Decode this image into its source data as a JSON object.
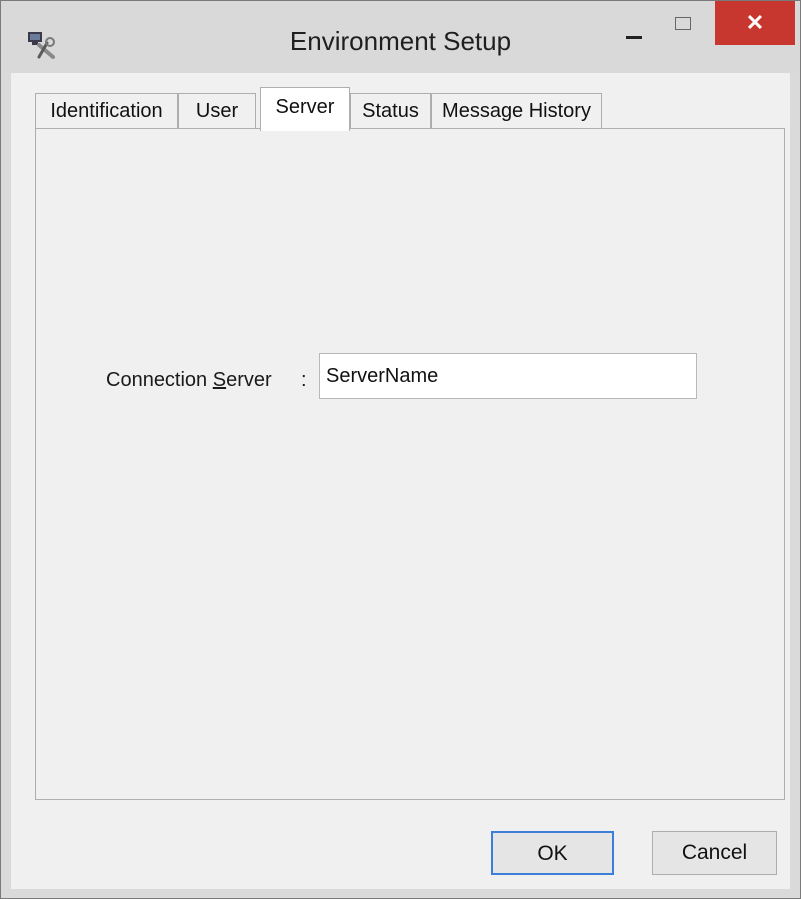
{
  "window": {
    "title": "Environment Setup",
    "close_glyph": "✕",
    "icons": [
      "app-tools-icon",
      "minimize-icon",
      "maximize-icon",
      "close-icon"
    ]
  },
  "tabs": [
    {
      "label": "Identification",
      "active": false
    },
    {
      "label": "User",
      "active": false
    },
    {
      "label": "Server",
      "active": true
    },
    {
      "label": "Status",
      "active": false
    },
    {
      "label": "Message History",
      "active": false
    }
  ],
  "server_tab": {
    "label_prefix": "Connection ",
    "label_accesskey": "S",
    "label_suffix": "erver",
    "colon": ":",
    "server_value": "ServerName"
  },
  "buttons": {
    "ok": "OK",
    "cancel": "Cancel"
  },
  "colors": {
    "close_button": "#c7372f",
    "default_button_border": "#3c7fd9",
    "dialog_background": "#f0f0f0"
  }
}
